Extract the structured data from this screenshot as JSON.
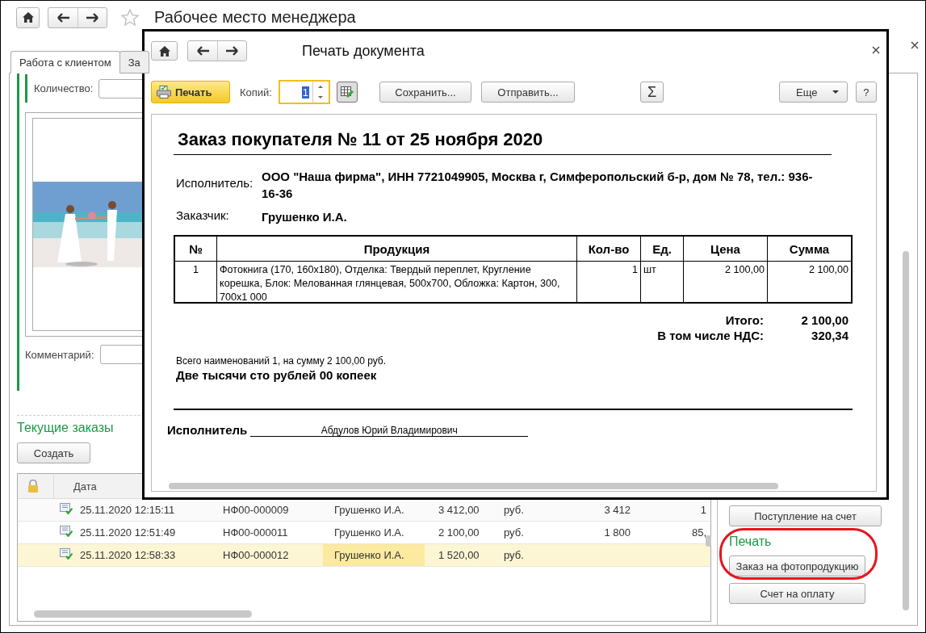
{
  "window": {
    "title": "Рабочее место менеджера",
    "tabs": [
      {
        "label": "Работа с клиентом",
        "selected": true
      },
      {
        "label": "За",
        "selected": false
      }
    ]
  },
  "client_form": {
    "quantity_label": "Количество:",
    "comment_label": "Комментарий:"
  },
  "orders": {
    "title": "Текущие заказы",
    "create_button": "Создать",
    "columns": [
      "Дата"
    ],
    "rows": [
      {
        "date": "25.11.2020 12:15:11",
        "number": "НФ00-000009",
        "customer": "Грушенко И.А.",
        "sum": "3 412,00",
        "currency": "руб.",
        "column_7": "3 412",
        "column_8": "1",
        "selected": false
      },
      {
        "date": "25.11.2020 12:51:49",
        "number": "НФ00-000011",
        "customer": "Грушенко И.А.",
        "sum": "2 100,00",
        "currency": "руб.",
        "column_7": "1 800",
        "column_8": "85,",
        "selected": false
      },
      {
        "date": "25.11.2020 12:58:33",
        "number": "НФ00-000012",
        "customer": "Грушенко И.А.",
        "sum": "1 520,00",
        "currency": "руб.",
        "column_7": "",
        "column_8": "",
        "selected": true
      }
    ]
  },
  "side_panel": {
    "top_button": "Поступление на счет",
    "print_title": "Печать",
    "print_buttons": [
      "Заказ на фотопродукцию",
      "Счет на оплату"
    ]
  },
  "dialog": {
    "title": "Печать документа",
    "toolbar": {
      "print_button": "Печать",
      "copies_label": "Копий:",
      "copies_value": "1",
      "save_button": "Сохранить...",
      "send_button": "Отправить...",
      "sum_button": "Σ",
      "more_button": "Еще",
      "help_button": "?"
    },
    "document": {
      "title": "Заказ покупателя № 11 от 25 ноября 2020",
      "parties": [
        {
          "label": "Исполнитель:",
          "value": "ООО \"Наша фирма\",  ИНН 7721049905,  Москва г, Симферопольский б-р, дом № 78,  тел.: 936-16-36"
        },
        {
          "label": "Заказчик:",
          "value": "Грушенко И.А."
        }
      ],
      "columns": [
        "№",
        "Продукция",
        "Кол-во",
        "Ед.",
        "Цена",
        "Сумма"
      ],
      "rows": [
        [
          "1",
          "Фотокнига (170, 160х180), Отделка: Твердый переплет, Кругление корешка, Блок: Мелованная глянцевая, 500х700, Обложка: Картон, 300, 700х1 000",
          "1",
          "шт",
          "2 100,00",
          "2 100,00"
        ]
      ],
      "totals": [
        {
          "label": "Итого:",
          "value": "2 100,00"
        },
        {
          "label": "В том числе НДС:",
          "value": "320,34"
        }
      ],
      "summary": "Всего наименований 1, на сумму 2 100,00 руб.",
      "amount_words": "Две тысячи сто рублей 00 копеек",
      "signature_label": "Исполнитель",
      "signature_name": "Абдулов Юрий Владимирович"
    }
  }
}
